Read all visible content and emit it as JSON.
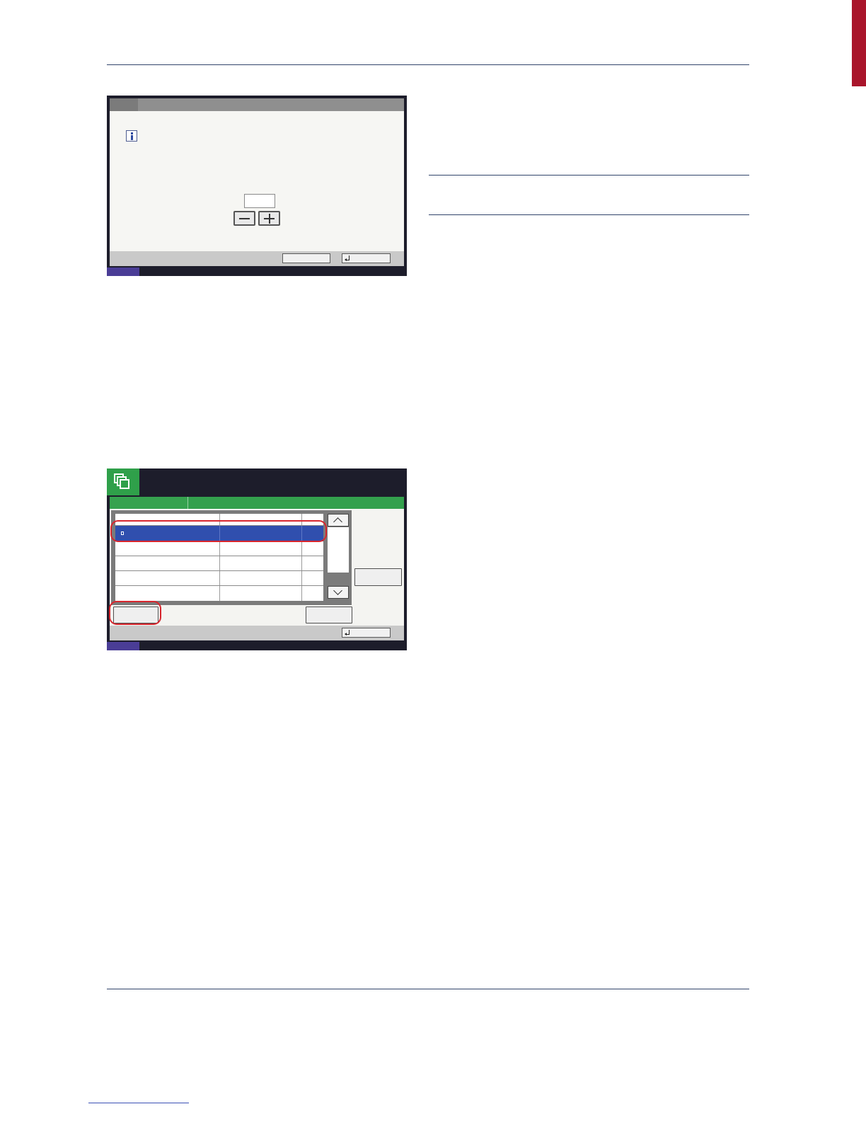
{
  "page": {
    "accent_color": "#a9152b",
    "rule_color": "#31446b"
  },
  "screen1": {
    "titlebar_text": "",
    "info_icon": "info-icon",
    "value": "",
    "minus_icon": "minus-icon",
    "plus_icon": "plus-icon",
    "cancel_label": "",
    "ok_label": "",
    "ok_icon": "enter-icon"
  },
  "screen2": {
    "mode_icon": "document-box-icon",
    "accent_color": "#33a04d",
    "selected_row_color": "#304fae",
    "highlight_color": "#d8262e",
    "up_icon": "chevron-up-icon",
    "down_icon": "chevron-down-icon",
    "close_icon": "enter-icon",
    "rows": 5,
    "selected_row": 1
  }
}
